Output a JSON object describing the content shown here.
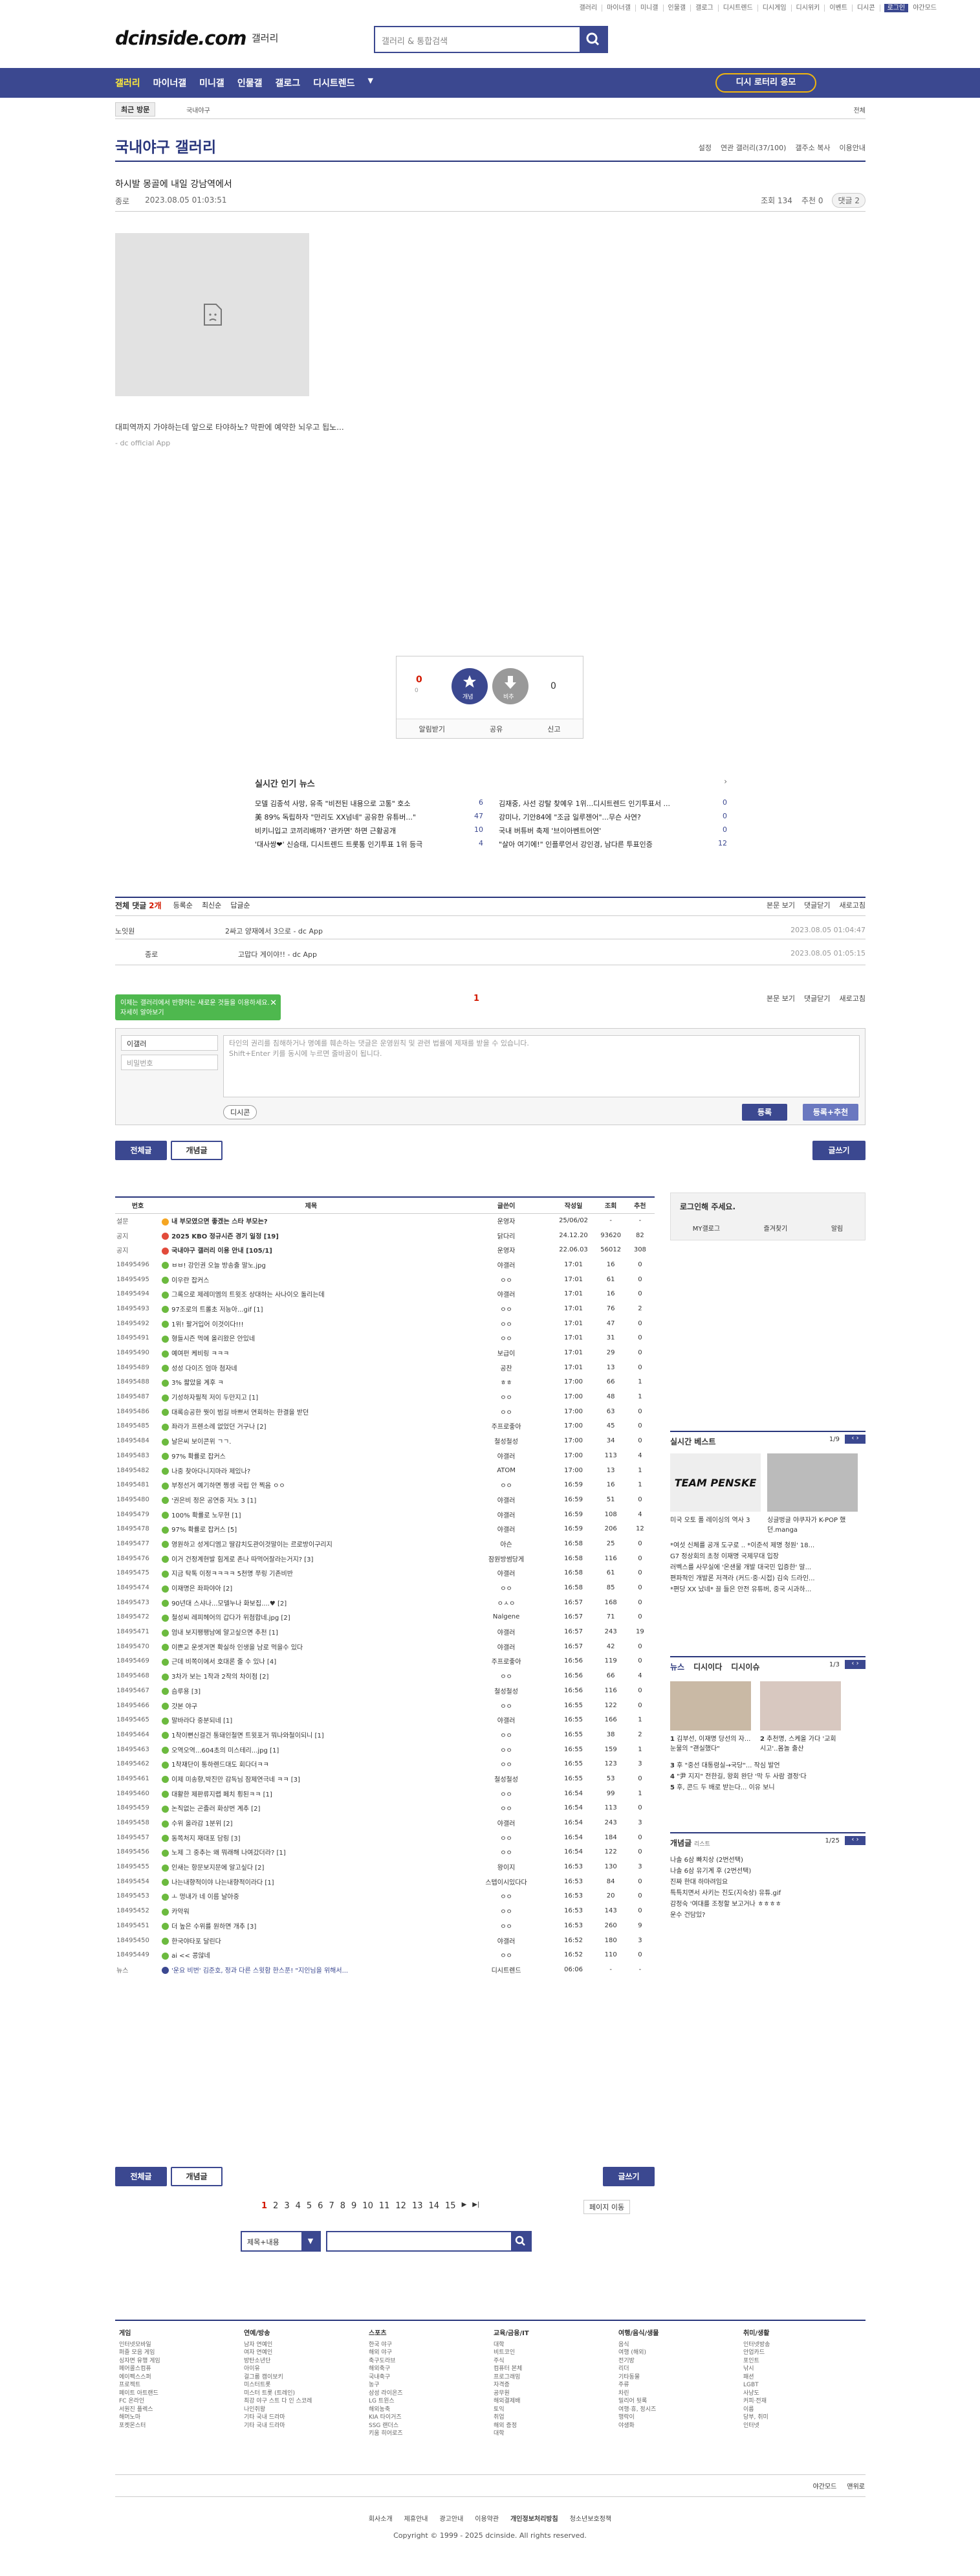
{
  "topnav": [
    "갤러리",
    "마이너갤",
    "미니갤",
    "인물갤",
    "갤로그",
    "디시트렌드",
    "디시게임",
    "디시위키",
    "이벤트",
    "디시콘"
  ],
  "topnav_login": "로그인",
  "topnav_night": "야간모드",
  "logo": "dcinside.com",
  "logo_gallery": "갤러리",
  "search_placeholder": "갤러리 & 통합검색",
  "gnb": [
    "갤러리",
    "마이너갤",
    "미니갤",
    "인물갤",
    "갤로그",
    "디시트렌드"
  ],
  "gnb_cta": "디시 로터리 응모",
  "recent_label": "최근 방문",
  "recent_item": "국내야구",
  "subbar_right": "전체",
  "gallery_title": "국내야구 갤러리",
  "title_links": [
    "설정",
    "연관 갤러리(37/100)",
    "갤주소 복사",
    "이용안내"
  ],
  "post": {
    "title": "하시발 몽골에 내일 강남역에서",
    "author": "종로",
    "date": "2023.08.05 01:03:51",
    "views": "조회 134",
    "recommend": "추천 0",
    "comment_pill": "댓글 2",
    "body": "대피역까지 가야하는데 앞으로 타야하노? 막판에 예약한 뇌우고 됩노...",
    "source": "- dc official App"
  },
  "recommend_box": {
    "up": "0",
    "up_sub": "0",
    "down": "0",
    "up_label": "개념",
    "down_label": "비추",
    "bottom": [
      "알림받기",
      "공유",
      "신고"
    ]
  },
  "news": {
    "heading": "실시간 인기 뉴스",
    "items": [
      {
        "t": "모델 김종석 사망, 유족 \"비전된 내용으로 고통\" 호소",
        "c": "6"
      },
      {
        "t": "김재중, 사선 강탈 찾예우 1위...디시트렌드 인기투표서 ...",
        "c": "0"
      },
      {
        "t": "美 89% 독립하자 \"만리도 XX넘네\" 공유한 유튜버...\"",
        "c": "47"
      },
      {
        "t": "강미나, 기안84에 \"조금 일루젠어\"...무슨 사연?",
        "c": "0"
      },
      {
        "t": "비키니입고 코끼리배까? '관카면' 하면 근황공개",
        "c": "10"
      },
      {
        "t": "국내 버튜버 축제 '브이아벤트어연'",
        "c": "0"
      },
      {
        "t": "'대사쌍❤' 신승태, 디시트렌드 트롯통 인기투표 1위 등극",
        "c": "4"
      },
      {
        "t": "\"살아 여기에!\" 인플루언서 강인경, 남다른 투표인증",
        "c": "12"
      }
    ]
  },
  "comments": {
    "total_label": "전체 댓글",
    "total": "2개",
    "sorts": [
      "등록순",
      "최신순",
      "답글순"
    ],
    "right": [
      "본문 보기",
      "댓글닫기",
      "새로고침"
    ],
    "items": [
      {
        "name": "노잇원",
        "text": "2싸고 양재에서 3으로 - dc App",
        "date": "2023.08.05 01:04:47"
      },
      {
        "name": "종로",
        "text": "고맙다 게이야!! - dc App",
        "date": "2023.08.05 01:05:15"
      }
    ],
    "page": "1"
  },
  "write": {
    "tooltip": "이제는 갤러리에서 반향하는 새로운 것들을 이용하세요. 자세히 알아보기",
    "nickname": "이갤러",
    "password_placeholder": "비밀번호",
    "textarea_placeholder": "타인의 권리를 침해하거나 명예를 훼손하는 댓글은 운영원칙 및 관련 법률에 제재를 받을 수 있습니다.\nShift+Enter 키를 동시에 누르면 줄바꿈이 됩니다.",
    "dccon": "디시콘",
    "submit": "등록",
    "submit_rec": "등록+추천"
  },
  "list_tabs": {
    "all": "전체글",
    "best": "개념글",
    "write": "글쓰기"
  },
  "table": {
    "headers": [
      "번호",
      "제목",
      "글쓴이",
      "작성일",
      "조회",
      "추천"
    ],
    "rows": [
      [
        "설문",
        "내 부모였으면 좋겠는 스타 부모는?",
        "운영자",
        "25/06/02",
        "-",
        "-",
        "o"
      ],
      [
        "공지",
        "2025 KBO 정규시즌 경기 일정 [19]",
        "닭다리",
        "24.12.20",
        "93620",
        "82",
        "r"
      ],
      [
        "공지",
        "국내야구 갤러리 이용 안내 [105/1]",
        "운영자",
        "22.06.03",
        "56012",
        "308",
        "r"
      ],
      [
        "18495496",
        "ㅂㅂ! 강인권 오늘 방송출 말노.jpg",
        "야갤러",
        "17:01",
        "16",
        "0",
        "g"
      ],
      [
        "18495495",
        "이우란 잡커스",
        "ㅇㅇ",
        "17:01",
        "61",
        "0",
        "g"
      ],
      [
        "18495494",
        "그록으로 제레미엠의 트윗조 상대하는 사나이오 돌리는데",
        "야갤러",
        "17:01",
        "16",
        "0",
        "g"
      ],
      [
        "18495493",
        "97조로의 트롤초 저능아...gif [1]",
        "ㅇㅇ",
        "17:01",
        "76",
        "2",
        "g"
      ],
      [
        "18495492",
        "1위! 팔거입어 이것이다!!!",
        "ㅇㅇ",
        "17:01",
        "47",
        "0",
        "g"
      ],
      [
        "18495491",
        "형들시즌 먹에 올리왔은 안있네",
        "ㅇㅇ",
        "17:01",
        "31",
        "0",
        "g"
      ],
      [
        "18495490",
        "예여펀 케비링 ㅋㅋㅋ",
        "보급이",
        "17:01",
        "29",
        "0",
        "g"
      ],
      [
        "18495489",
        "성성 다이즈 엄마 첨자네",
        "공찬",
        "17:01",
        "13",
        "0",
        "g"
      ],
      [
        "18495488",
        "3% 짧았을 계후 ㅋ",
        "ㅎㅎ",
        "17:00",
        "66",
        "1",
        "g"
      ],
      [
        "18495487",
        "기성하자필적 저이 두만지고 [1]",
        "ㅇㅇ",
        "17:00",
        "48",
        "1",
        "g"
      ],
      [
        "18495486",
        "대록승공한 뭣이 범길 바쁘서 연회하는 한결을 받던",
        "ㅇㅇ",
        "17:00",
        "63",
        "0",
        "g"
      ],
      [
        "18495485",
        "좌라가 프렌소례 없었던 거구나 [2]",
        "주프로좋아",
        "17:00",
        "45",
        "0",
        "g"
      ],
      [
        "18495484",
        "날은씨 보이콘위 ㄱㄱ.",
        "철성철성",
        "17:00",
        "34",
        "0",
        "g"
      ],
      [
        "18495483",
        "97% 확률로 잡커스",
        "야갤러",
        "17:00",
        "113",
        "4",
        "g"
      ],
      [
        "18495482",
        "나중 찾아다니지마라 제있나?",
        "ATOM",
        "17:00",
        "13",
        "1",
        "g"
      ],
      [
        "18495481",
        "부정선거 예기하면 쩡생 국립 안 찍음 ㅇㅇ",
        "ㅇㅇ",
        "16:59",
        "16",
        "1",
        "g"
      ],
      [
        "18495480",
        "'권은비 정은 공연중 저노 3 [1]",
        "야갤러",
        "16:59",
        "51",
        "0",
        "g"
      ],
      [
        "18495479",
        "100% 확률로 노무현 [1]",
        "야갤러",
        "16:59",
        "108",
        "4",
        "g"
      ],
      [
        "18495478",
        "97% 확률로 잡커스 [5]",
        "야갤러",
        "16:59",
        "206",
        "12",
        "g"
      ],
      [
        "18495477",
        "영원하고 성게디엠고 딸감치도관이것말이는 르로방이구리지",
        "아슨",
        "16:58",
        "25",
        "0",
        "g"
      ],
      [
        "18495476",
        "이거 건정계현발 힘게로 존나 따먹어잘라는거지? [3]",
        "잠원방썸당게",
        "16:58",
        "116",
        "0",
        "g"
      ],
      [
        "18495475",
        "지금 탁톡 이정ㅋㅋㅋㅋ 5천명 쭈링 기존비반",
        "야갤러",
        "16:58",
        "61",
        "0",
        "g"
      ],
      [
        "18495474",
        "이재명은 좌파야아 [2]",
        "ㅇㅇ",
        "16:58",
        "85",
        "0",
        "g"
      ],
      [
        "18495473",
        "90년대 스샤나...모델누나 화보집....♥ [2]",
        "ㅇㅅㅇ",
        "16:57",
        "168",
        "0",
        "g"
      ],
      [
        "18495472",
        "철성씨 레피헤어의 갑다가 위첨합네.jpg [2]",
        "Nalgene",
        "16:57",
        "71",
        "0",
        "g"
      ],
      [
        "18495471",
        "엄내 보지팽팽남에 얄고싶으면 추천 [1]",
        "야갤러",
        "16:57",
        "243",
        "19",
        "g"
      ],
      [
        "18495470",
        "이쁜교 운셋겨면 확실하 인생을 남로 먹을수 있다",
        "야갤러",
        "16:57",
        "42",
        "0",
        "g"
      ],
      [
        "18495469",
        "근데 비쪽이에서 호대론 줄 수 있나 [4]",
        "주프로좋아",
        "16:56",
        "119",
        "0",
        "g"
      ],
      [
        "18495468",
        "3차가 보는 1작과 2작의 차이점 [2]",
        "ㅇㅇ",
        "16:56",
        "66",
        "4",
        "g"
      ],
      [
        "18495467",
        "슴루용 [3]",
        "철성철성",
        "16:56",
        "116",
        "0",
        "g"
      ],
      [
        "18495466",
        "갓본 야구",
        "ㅇㅇ",
        "16:55",
        "122",
        "0",
        "g"
      ],
      [
        "18495465",
        "말바라다 중분되네 [1]",
        "야갤러",
        "16:55",
        "166",
        "1",
        "g"
      ],
      [
        "18495464",
        "1착이뻔신걸건 통돼인철면 트윗포거 뭐나와철이되니 [1]",
        "ㅇㅇ",
        "16:55",
        "38",
        "2",
        "g"
      ],
      [
        "18495463",
        "오역오역...604초의 미스테리...jpg [1]",
        "ㅇㅇ",
        "16:55",
        "159",
        "1",
        "g"
      ],
      [
        "18495462",
        "1착재단이 통하렌드대도 회다더ㅋㅋ",
        "ㅇㅇ",
        "16:55",
        "123",
        "3",
        "g"
      ],
      [
        "18495461",
        "이제 미송향,박진만 감독님 잠제연극네 ㅋㅋ [3]",
        "철성철성",
        "16:55",
        "53",
        "0",
        "g"
      ],
      [
        "18495460",
        "대활한 제판류지랩 페치 횡된ㅋㅋ [1]",
        "ㅇㅇ",
        "16:54",
        "99",
        "1",
        "g"
      ],
      [
        "18495459",
        "논직없는 곤졸러 화상번 계추 [2]",
        "ㅇㅇ",
        "16:54",
        "113",
        "0",
        "g"
      ],
      [
        "18495458",
        "수위 올라감 1분위 [2]",
        "야갤러",
        "16:54",
        "243",
        "3",
        "g"
      ],
      [
        "18495457",
        "동쪽처지 재대포 담링 [3]",
        "ㅇㅇ",
        "16:54",
        "184",
        "0",
        "g"
      ],
      [
        "18495456",
        "노제 그 중추는 왜 뭐래해 나여갔더라? [1]",
        "ㅇㅇ",
        "16:54",
        "122",
        "0",
        "g"
      ],
      [
        "18495455",
        "인새는 항문보지문에 알고싶다 [2]",
        "왕이지",
        "16:53",
        "130",
        "3",
        "g"
      ],
      [
        "18495454",
        "나는내향적이야 나는내향적이라다 [1]",
        "스텝이시있다다",
        "16:53",
        "84",
        "0",
        "g"
      ],
      [
        "18495453",
        "ㅗ 멍내가 네 이름 날아중",
        "ㅇㅇ",
        "16:53",
        "20",
        "0",
        "g"
      ],
      [
        "18495452",
        "카악워",
        "ㅇㅇ",
        "16:53",
        "143",
        "0",
        "g"
      ],
      [
        "18495451",
        "더 높은 수위를 원하면 개추 [3]",
        "ㅇㅇ",
        "16:53",
        "260",
        "9",
        "g"
      ],
      [
        "18495450",
        "한국야타포 달린다",
        "야갤러",
        "16:52",
        "180",
        "3",
        "g"
      ],
      [
        "18495449",
        "ai << 콩않네",
        "ㅇㅇ",
        "16:52",
        "110",
        "0",
        "g"
      ],
      [
        "뉴스",
        "'운요 비번' 김준호, 정과 다른 스윗함 한스푼! \"지인님을 위해서...",
        "디시트렌드",
        "06:06",
        "-",
        "-",
        "b"
      ]
    ]
  },
  "pagination": [
    "1",
    "2",
    "3",
    "4",
    "5",
    "6",
    "7",
    "8",
    "9",
    "10",
    "11",
    "12",
    "13",
    "14",
    "15"
  ],
  "page_move": "페이지 이동",
  "bottom_search_select": "제목+내용",
  "sidebar": {
    "login_text": "로그인해 주세요.",
    "login_links": [
      "MY갤로그",
      "즐겨찾기",
      "알림"
    ],
    "best_title": "실시간 베스트",
    "best_page": "1/9",
    "best_items": [
      {
        "t": "미국 오토 폴 레이싱의 역사 3",
        "img": "TEAM PENSKE"
      },
      {
        "t": "싱글벙글 야쿠자가 K-POP 했던.manga",
        "img": ""
      }
    ],
    "best_list": [
      "*여섯 신체를 공개 도구로 .. *이준석 제명 청원' 18...",
      "G7 정상회의 초청 이재명 국제무대 입장",
      "러벡스를 사무실에 '온샌물 개발 대국민 입증한' 말...",
      "편파적인 개발론 저격라 (커드·중·시접) 김숙 드라인...",
      "*편당 XX 났네* 끌 들은 안전 유튜버, 중국 시과하..."
    ],
    "news_tabs": [
      "뉴스",
      "디시이다",
      "디시이슈"
    ],
    "news_page": "1/3",
    "news_cards": [
      {
        "n": "1",
        "t": "김부선, 이재명 당선의 자... 눈물의 \"괜실했다\""
      },
      {
        "n": "2",
        "t": "추천명, 스케올 가다 '교회시고'..몸놀 출산"
      }
    ],
    "news_list": [
      {
        "n": "3",
        "t": "후 \"중선 대통령실→국당\"... 작심 발언"
      },
      {
        "n": "4",
        "t": "\"尹 지지\" 전한길, 왕회 완단 '막 두 사람 결정'다"
      },
      {
        "n": "5",
        "t": "후, 콘드 두 배로 받는다... 이유 보니"
      }
    ],
    "gaenyeom_title": "개념글",
    "gaenyeom_sub": "리스트",
    "gaenyeom_page": "1/25",
    "gaenyeom_list": [
      "나솔 6삼 빠치상 (2번선택)",
      "나솔 6삼 유기계 후 (2번선택)",
      "진짜 한대 하마려임요",
      "특특치면서 사키는 진도(지숙상) 유튜.gif",
      "감정숙 '여대를 조정할 보고거나 ㅎㅎㅎㅎ",
      "운수 건담있?"
    ]
  },
  "footer": {
    "cols": [
      {
        "h": "게임",
        "items": [
          "인터넷모바일",
          "퍼즐 모음 게임",
          "싱자면 유행 게임",
          "페어콜스컴퓨",
          "에이펙스스퍼",
          "프로젝트",
          "페이트 아트랜드",
          "FC 온라인",
          "서원진 플렉스",
          "해머노마",
          "포켓몬스터"
        ]
      },
      {
        "h": "연예/방송",
        "items": [
          "남자 연예인",
          "여자 연예인",
          "방탄소년단",
          "아이유",
          "걸그룹 캠이보키",
          "미스터트롯",
          "미스터 트롯 (트레인)",
          "최강 야구 스트 다 인 스코레",
          "나인쥐왕",
          "기타 국내 드라마",
          "기타 국내 드라마"
        ]
      },
      {
        "h": "스포츠",
        "items": [
          "한국 야구",
          "해외 야구",
          "축구도라브",
          "해외축구",
          "국내축구",
          "농구",
          "삼성 라이온즈",
          "LG 트윈스",
          "해외농축",
          "KIA 타이거즈",
          "SSG 랜더스",
          "키움 히어로즈"
        ]
      },
      {
        "h": "교육/금융/IT",
        "items": [
          "대학",
          "비트코인",
          "주식",
          "컴퓨터 본체",
          "프로그래밍",
          "자격증",
          "공무원",
          "해외결제배",
          "토익",
          "취업",
          "해외 증정",
          "대학"
        ]
      },
      {
        "h": "여행/음식/생물",
        "items": [
          "음식",
          "여행 (해외)",
          "전기방",
          "리더",
          "기타동물",
          "주류",
          "차린",
          "밀리어 뒷록",
          "여행·휴, 정시즈",
          "행락이",
          "야생화"
        ]
      },
      {
        "h": "취미/생활",
        "items": [
          "인터넷방송",
          "안업카드",
          "포인트",
          "낚시",
          "패션",
          "LGBT",
          "사냥도",
          "커피·전재",
          "이름",
          "당부, 취미",
          "인터넷"
        ]
      }
    ],
    "util": [
      "야간모드",
      "맨위로"
    ],
    "links": [
      "회사소개",
      "제휴안내",
      "광고안내",
      "이용약관",
      "개인정보처리방침",
      "청소년보호정책"
    ],
    "copyright": "Copyright © 1999 - 2025 dcinside. All rights reserved."
  }
}
